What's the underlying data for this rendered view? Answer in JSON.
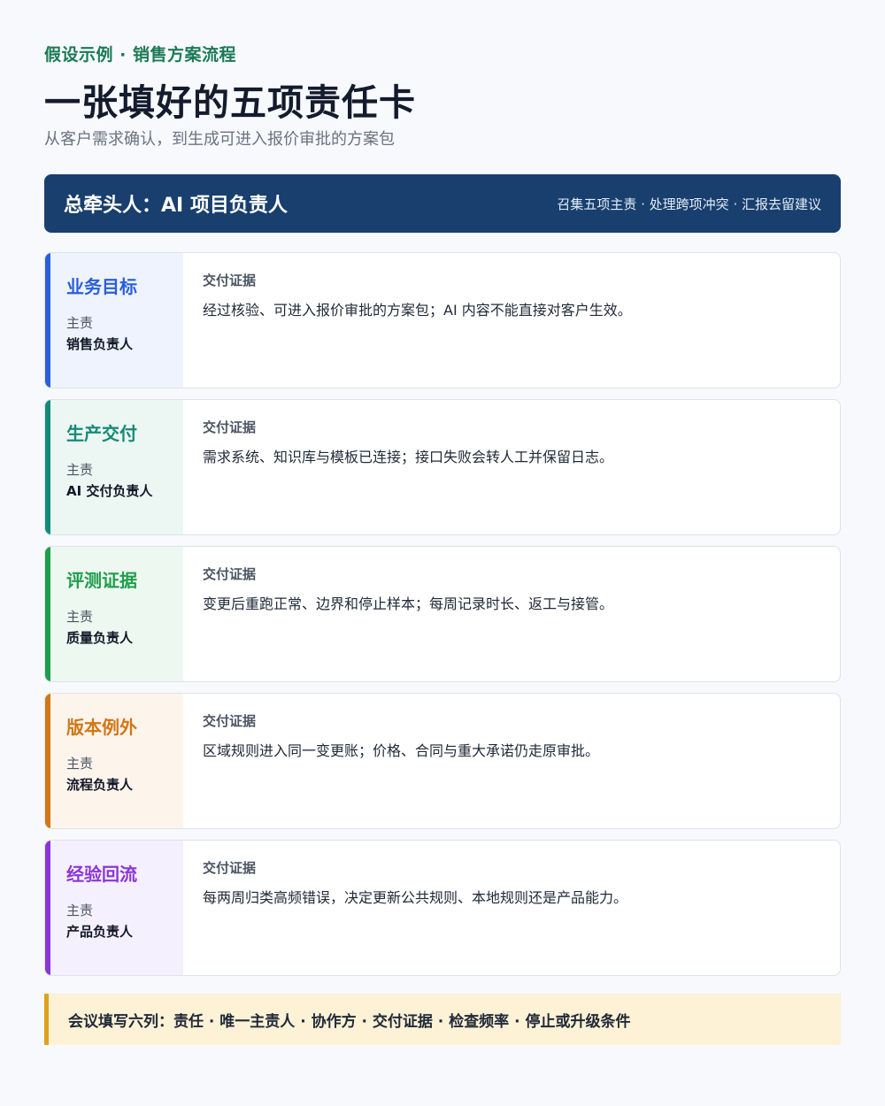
{
  "header": {
    "kicker": "假设示例 · 销售方案流程",
    "title": "一张填好的五项责任卡",
    "subtitle": "从客户需求确认，到生成可进入报价审批的方案包"
  },
  "banner": {
    "title": "总牵头人：AI 项目负责人",
    "note": "召集五项主责 · 处理跨项冲突 · 汇报去留建议"
  },
  "cards": [
    {
      "name": "业务目标",
      "role_label": "主责",
      "owner": "销售负责人",
      "evidence_label": "交付证据",
      "evidence": "经过核验、可进入报价审批的方案包；AI 内容不能直接对客户生效。",
      "accent": "#2b5fd9",
      "side_bg": "#eef3fd"
    },
    {
      "name": "生产交付",
      "role_label": "主责",
      "owner": "AI 交付负责人",
      "evidence_label": "交付证据",
      "evidence": "需求系统、知识库与模板已连接；接口失败会转人工并保留日志。",
      "accent": "#148a78",
      "side_bg": "#ecf6f3"
    },
    {
      "name": "评测证据",
      "role_label": "主责",
      "owner": "质量负责人",
      "evidence_label": "交付证据",
      "evidence": "变更后重跑正常、边界和停止样本；每周记录时长、返工与接管。",
      "accent": "#1f9d4d",
      "side_bg": "#edf8f1"
    },
    {
      "name": "版本例外",
      "role_label": "主责",
      "owner": "流程负责人",
      "evidence_label": "交付证据",
      "evidence": "区域规则进入同一变更账；价格、合同与重大承诺仍走原审批。",
      "accent": "#d27716",
      "side_bg": "#fdf4ec"
    },
    {
      "name": "经验回流",
      "role_label": "主责",
      "owner": "产品负责人",
      "evidence_label": "交付证据",
      "evidence": "每两周归类高频错误，决定更新公共规则、本地规则还是产品能力。",
      "accent": "#8a35d8",
      "side_bg": "#f5f0fd"
    }
  ],
  "footer": {
    "text": "会议填写六列：责任 · 唯一主责人 · 协作方 · 交付证据 · 检查频率 · 停止或升级条件"
  }
}
